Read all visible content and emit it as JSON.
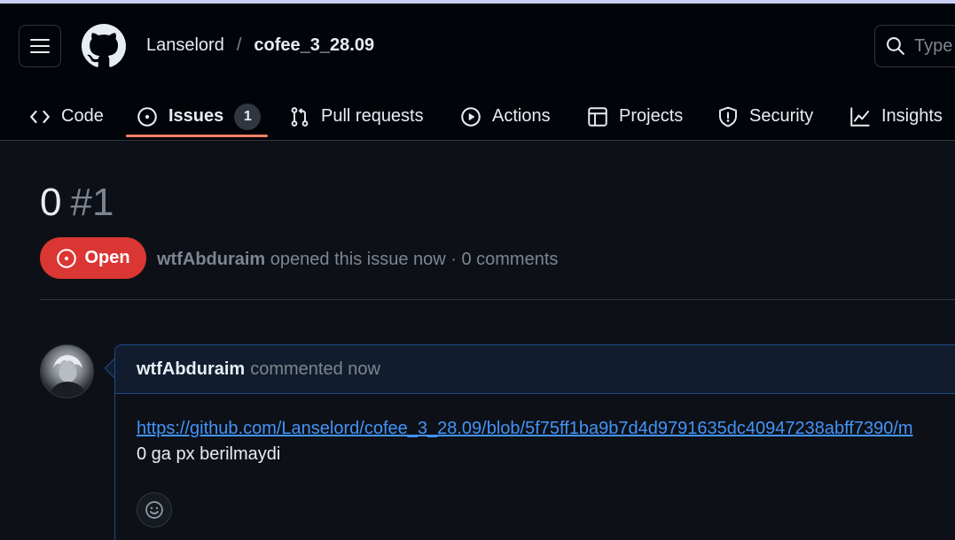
{
  "header": {
    "owner": "Lanselord",
    "separator": "/",
    "repo": "cofee_3_28.09",
    "search_placeholder": "Type"
  },
  "tabs": [
    {
      "label": "Code",
      "icon": "code-icon"
    },
    {
      "label": "Issues",
      "icon": "issue-opened-icon",
      "counter": "1",
      "active": true
    },
    {
      "label": "Pull requests",
      "icon": "git-pull-request-icon"
    },
    {
      "label": "Actions",
      "icon": "play-icon"
    },
    {
      "label": "Projects",
      "icon": "table-icon"
    },
    {
      "label": "Security",
      "icon": "shield-icon"
    },
    {
      "label": "Insights",
      "icon": "graph-icon"
    }
  ],
  "issue": {
    "title": "0",
    "number": "#1",
    "state": "Open",
    "author": "wtfAbduraim",
    "meta_text": "opened this issue now · 0 comments"
  },
  "comment": {
    "author": "wtfAbduraim",
    "action": "commented now",
    "link": "https://github.com/Lanselord/cofee_3_28.09/blob/5f75ff1ba9b7d4d9791635dc40947238abff7390/m",
    "text": "0 ga px berilmaydi"
  },
  "colors": {
    "accent_underline": "#f78166",
    "open_badge": "#da3633",
    "link": "#4493f8",
    "background": "#0d1117"
  }
}
